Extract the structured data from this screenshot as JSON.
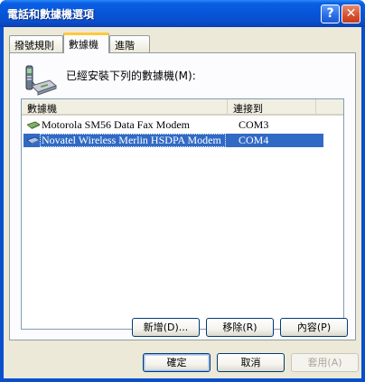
{
  "window": {
    "title": "電話和數據機選項",
    "help_glyph": "?",
    "close_glyph": "✕"
  },
  "tabs": [
    {
      "label": "撥號規則",
      "active": false
    },
    {
      "label": "數據機",
      "active": true
    },
    {
      "label": "進階",
      "active": false
    }
  ],
  "panel": {
    "icon": "phone-modem-icon",
    "prompt_label": "已經安裝下列的數據機(M):"
  },
  "modem_list": {
    "columns": [
      "數據機",
      "連接到"
    ],
    "rows": [
      {
        "name": "Motorola SM56 Data Fax Modem",
        "port": "COM3",
        "selected": false,
        "icon": "modem-icon"
      },
      {
        "name": "Novatel Wireless Merlin HSDPA Modem",
        "port": "COM4",
        "selected": true,
        "icon": "modem-icon"
      }
    ]
  },
  "panel_buttons": {
    "add": "新增(D)...",
    "remove": "移除(R)",
    "properties": "內容(P)"
  },
  "dialog_buttons": {
    "ok": "確定",
    "cancel": "取消",
    "apply": "套用(A)"
  },
  "colors": {
    "titlebar": "#0755d8",
    "selection": "#316ac5",
    "tab_highlight": "#ffc83c",
    "face": "#ece9d8"
  }
}
